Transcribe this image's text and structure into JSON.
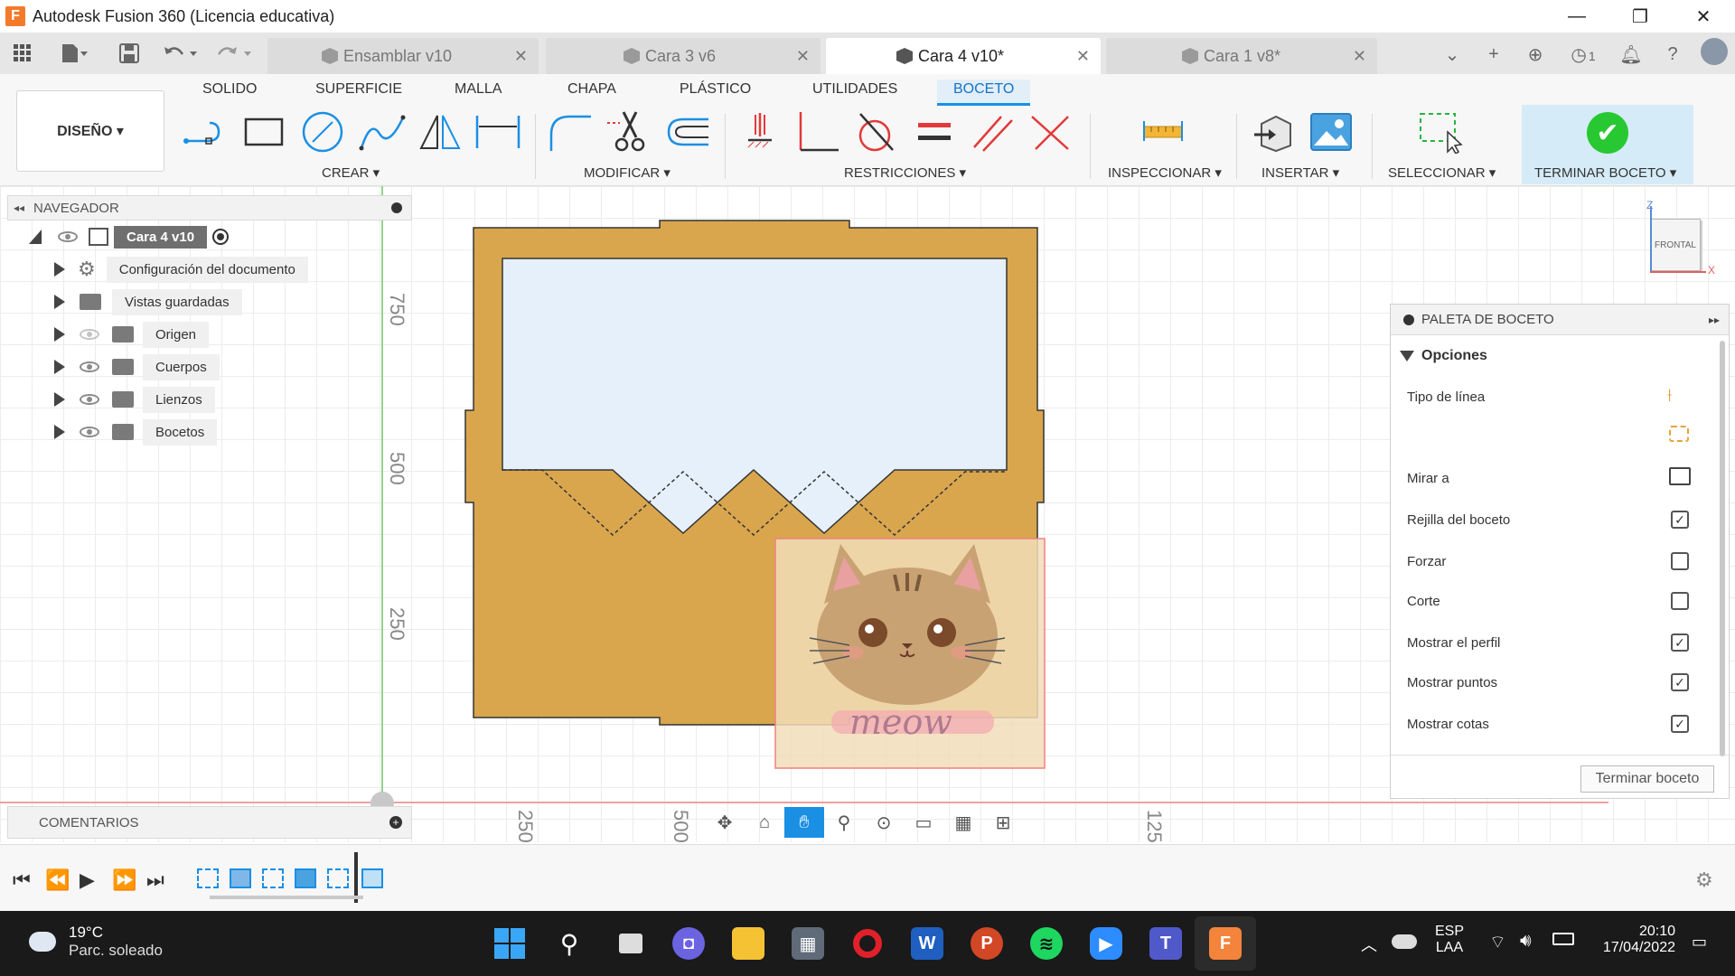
{
  "window": {
    "title": "Autodesk Fusion 360 (Licencia educativa)",
    "logo": "F",
    "minimize": "—",
    "maximize": "❐",
    "close": "✕"
  },
  "tabs": [
    {
      "label": "Ensamblar v10",
      "close": "✕"
    },
    {
      "label": "Cara 3 v6",
      "close": "✕"
    },
    {
      "label": "Cara 4 v10*",
      "close": "✕"
    },
    {
      "label": "Cara 1 v8*",
      "close": "✕"
    }
  ],
  "tabbar": {
    "jobs_count": "1"
  },
  "ribbon": {
    "workspace": "DISEÑO ▾",
    "tabs": [
      "SOLIDO",
      "SUPERFICIE",
      "MALLA",
      "CHAPA",
      "PLÁSTICO",
      "UTILIDADES",
      "BOCETO"
    ],
    "active_tab": "BOCETO",
    "groups": [
      "CREAR ▾",
      "MODIFICAR ▾",
      "RESTRICCIONES ▾",
      "INSPECCIONAR ▾",
      "INSERTAR ▾",
      "SELECCIONAR ▾",
      "TERMINAR BOCETO ▾"
    ]
  },
  "browser": {
    "title": "NAVEGADOR",
    "root": "Cara 4 v10",
    "items": [
      "Configuración del documento",
      "Vistas guardadas",
      "Origen",
      "Cuerpos",
      "Lienzos",
      "Bocetos"
    ]
  },
  "canvas": {
    "dims_vertical": [
      "750",
      "500",
      "250"
    ],
    "dims_horizontal": [
      "250",
      "500",
      "125"
    ],
    "viewcube": {
      "face": "FRONTAL",
      "z": "Z",
      "x": "X"
    },
    "canvas_text": "meow"
  },
  "palette": {
    "title": "PALETA DE BOCETO",
    "section": "Opciones",
    "rows": [
      {
        "label": "Tipo de línea",
        "checked": null
      },
      {
        "label": "Mirar a",
        "checked": null
      },
      {
        "label": "Rejilla del boceto",
        "checked": true
      },
      {
        "label": "Forzar",
        "checked": false
      },
      {
        "label": "Corte",
        "checked": false
      },
      {
        "label": "Mostrar el perfil",
        "checked": true
      },
      {
        "label": "Mostrar puntos",
        "checked": true
      },
      {
        "label": "Mostrar cotas",
        "checked": true
      }
    ],
    "finish_button": "Terminar boceto"
  },
  "comments": {
    "title": "COMENTARIOS"
  },
  "taskbar": {
    "temperature": "19°C",
    "weather": "Parc. soleado",
    "lang1": "ESP",
    "lang2": "LAA",
    "time": "20:10",
    "date": "17/04/2022"
  },
  "colors": {
    "accent": "#1b8fe3",
    "sketch_fill": "#d9a64e",
    "profile_fill": "#e6f0fb",
    "finish_green": "#28c832"
  }
}
